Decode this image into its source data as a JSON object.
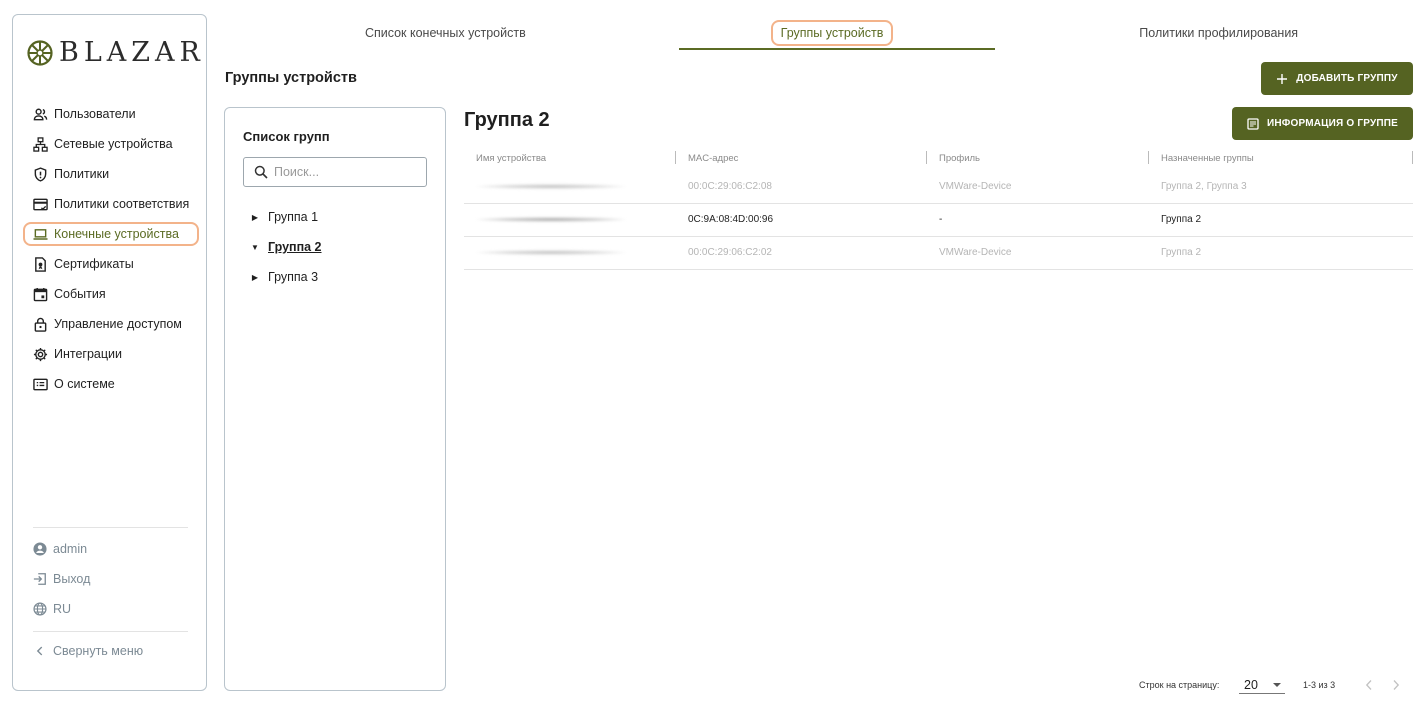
{
  "brand": {
    "name": "BLAZAR"
  },
  "sidebar": {
    "items": [
      {
        "label": "Пользователи",
        "icon": "users-icon"
      },
      {
        "label": "Сетевые устройства",
        "icon": "network-icon"
      },
      {
        "label": "Политики",
        "icon": "shield-icon"
      },
      {
        "label": "Политики соответствия",
        "icon": "compliance-icon"
      },
      {
        "label": "Конечные устройства",
        "icon": "laptop-icon",
        "active": true
      },
      {
        "label": "Сертификаты",
        "icon": "certificate-icon"
      },
      {
        "label": "События",
        "icon": "calendar-icon"
      },
      {
        "label": "Управление доступом",
        "icon": "lock-icon"
      },
      {
        "label": "Интеграции",
        "icon": "gear-icon"
      },
      {
        "label": "О системе",
        "icon": "info-icon"
      }
    ],
    "user": "admin",
    "logout": "Выход",
    "language": "RU",
    "collapse": "Свернуть меню"
  },
  "tabs": [
    {
      "label": "Список конечных устройств"
    },
    {
      "label": "Группы устройств",
      "active": true
    },
    {
      "label": "Политики профилирования"
    }
  ],
  "page": {
    "title": "Группы устройств",
    "add_group_label": "ДОБАВИТЬ ГРУППУ",
    "group_info_label": "ИНФОРМАЦИЯ О ГРУППЕ"
  },
  "group_list": {
    "title": "Список групп",
    "search_placeholder": "Поиск...",
    "groups": [
      {
        "label": "Группа 1",
        "expanded": false,
        "selected": false
      },
      {
        "label": "Группа 2",
        "expanded": true,
        "selected": true
      },
      {
        "label": "Группа 3",
        "expanded": false,
        "selected": false
      }
    ]
  },
  "group_detail": {
    "title": "Группа 2",
    "columns": [
      "Имя устройства",
      "MAC-адрес",
      "Профиль",
      "Назначенные группы"
    ],
    "rows": [
      {
        "mac": "00:0C:29:06:C2:08",
        "profile": "VMWare-Device",
        "groups": "Группа 2, Группа 3",
        "dim": true
      },
      {
        "mac": "0C:9A:08:4D:00:96",
        "profile": "-",
        "groups": "Группа 2",
        "dim": false
      },
      {
        "mac": "00:0C:29:06:C2:02",
        "profile": "VMWare-Device",
        "groups": "Группа 2",
        "dim": true
      }
    ]
  },
  "pagination": {
    "rows_per_page_label": "Строк на страницу:",
    "rows_per_page": "20",
    "range": "1-3 из 3"
  },
  "colors": {
    "accent": "#556322",
    "highlight": "#f3b38a",
    "border": "#b9c4cc"
  }
}
